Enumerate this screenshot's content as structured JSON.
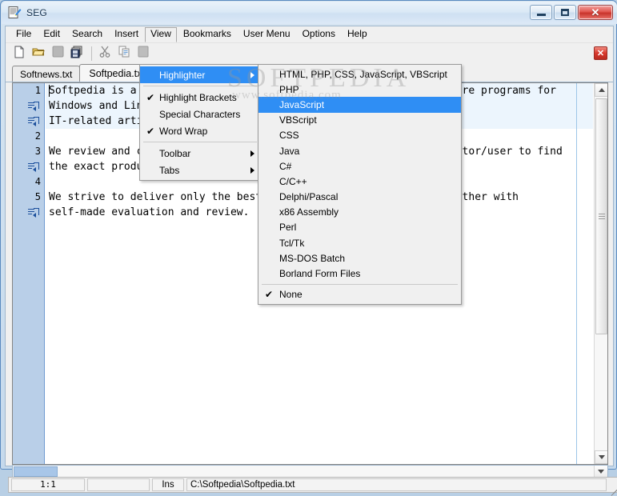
{
  "window": {
    "title": "SEG",
    "icon": "document-edit-icon",
    "buttons": {
      "minimize": "minimize-icon",
      "maximize": "maximize-icon",
      "close": "✕"
    }
  },
  "menubar": {
    "items": [
      {
        "label": "File",
        "open": false
      },
      {
        "label": "Edit",
        "open": false
      },
      {
        "label": "Search",
        "open": false
      },
      {
        "label": "Insert",
        "open": false
      },
      {
        "label": "View",
        "open": true
      },
      {
        "label": "Bookmarks",
        "open": false
      },
      {
        "label": "User Menu",
        "open": false
      },
      {
        "label": "Options",
        "open": false
      },
      {
        "label": "Help",
        "open": false
      }
    ]
  },
  "toolbar": {
    "buttons": [
      {
        "name": "new-file-icon"
      },
      {
        "name": "open-folder-icon"
      },
      {
        "name": "save-icon"
      },
      {
        "name": "save-all-icon"
      },
      {
        "name": "separator"
      },
      {
        "name": "cut-icon"
      },
      {
        "name": "copy-icon"
      },
      {
        "name": "paste-icon"
      }
    ],
    "close_label": "✕"
  },
  "tabs": [
    {
      "label": "Softnews.txt",
      "active": false
    },
    {
      "label": "Softpedia.txt",
      "active": true
    }
  ],
  "view_menu": {
    "items": [
      {
        "label": "Highlighter",
        "checked": false,
        "submenu": true,
        "highlighted": true,
        "separator_after": true
      },
      {
        "label": "Highlight Brackets",
        "checked": true,
        "submenu": false,
        "highlighted": false
      },
      {
        "label": "Special Characters",
        "checked": false,
        "submenu": false,
        "highlighted": false
      },
      {
        "label": "Word Wrap",
        "checked": true,
        "submenu": false,
        "highlighted": false,
        "separator_after": true
      },
      {
        "label": "Toolbar",
        "checked": false,
        "submenu": true,
        "highlighted": false
      },
      {
        "label": "Tabs",
        "checked": false,
        "submenu": true,
        "highlighted": false
      }
    ]
  },
  "highlighter_submenu": {
    "items": [
      {
        "label": "HTML, PHP, CSS, JavaScript, VBScript",
        "checked": false,
        "highlighted": false
      },
      {
        "label": "PHP",
        "checked": false,
        "highlighted": false
      },
      {
        "label": "JavaScript",
        "checked": false,
        "highlighted": true
      },
      {
        "label": "VBScript",
        "checked": false,
        "highlighted": false
      },
      {
        "label": "CSS",
        "checked": false,
        "highlighted": false
      },
      {
        "label": "Java",
        "checked": false,
        "highlighted": false
      },
      {
        "label": "C#",
        "checked": false,
        "highlighted": false
      },
      {
        "label": "C/C++",
        "checked": false,
        "highlighted": false
      },
      {
        "label": "Delphi/Pascal",
        "checked": false,
        "highlighted": false
      },
      {
        "label": "x86 Assembly",
        "checked": false,
        "highlighted": false
      },
      {
        "label": "Perl",
        "checked": false,
        "highlighted": false
      },
      {
        "label": "Tcl/Tk",
        "checked": false,
        "highlighted": false
      },
      {
        "label": "MS-DOS Batch",
        "checked": false,
        "highlighted": false
      },
      {
        "label": "Borland Form Files",
        "checked": false,
        "highlighted": false,
        "separator_after": true
      },
      {
        "label": "None",
        "checked": true,
        "highlighted": false
      }
    ]
  },
  "editor": {
    "lines": [
      {
        "gutter": "1",
        "wrap": false,
        "text": "Softpedia is a library of over 400,000 free and free-to-try software programs for",
        "selected": true
      },
      {
        "gutter": "wrap",
        "wrap": true,
        "text": "Windows and Linux/Unix, Mac OS X, Handheld/PDA, Mobile devices and",
        "selected": true
      },
      {
        "gutter": "wrap",
        "wrap": true,
        "text": "IT-related articles.",
        "selected": true
      },
      {
        "gutter": "2",
        "wrap": false,
        "text": "",
        "selected": false
      },
      {
        "gutter": "3",
        "wrap": false,
        "text": "We review and categorize these products in order to allow the visitor/user to find",
        "selected": false
      },
      {
        "gutter": "wrap",
        "wrap": true,
        "text": "the exact product they and their system needs.",
        "selected": false
      },
      {
        "gutter": "4",
        "wrap": false,
        "text": "",
        "selected": false
      },
      {
        "gutter": "5",
        "wrap": false,
        "text": "We strive to deliver only the best and most valuable software together with",
        "selected": false
      },
      {
        "gutter": "wrap",
        "wrap": true,
        "text": "self-made evaluation and review.",
        "selected": false
      }
    ]
  },
  "statusbar": {
    "position": "1:1",
    "blank": "",
    "insert_mode": "Ins",
    "file_path": "C:\\Softpedia\\Softpedia.txt"
  },
  "watermark": {
    "line1": "SOFTPEDIA",
    "line2": "www.softpedia.com"
  },
  "colors": {
    "accent": "#2f8ef4",
    "gutter": "#b9cfe8",
    "selection": "#ecf5fd",
    "close_red": "#d9382c"
  }
}
